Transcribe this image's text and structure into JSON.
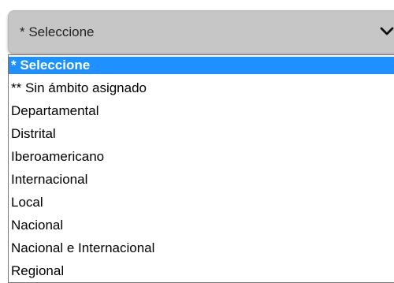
{
  "select": {
    "value": "* Seleccione",
    "icon": "chevron-down-icon"
  },
  "options": [
    {
      "label": "* Seleccione",
      "selected": true
    },
    {
      "label": "** Sin ámbito asignado"
    },
    {
      "label": "Departamental"
    },
    {
      "label": "Distrital"
    },
    {
      "label": "Iberoamericano"
    },
    {
      "label": "Internacional"
    },
    {
      "label": "Local"
    },
    {
      "label": "Nacional"
    },
    {
      "label": "Nacional e Internacional"
    },
    {
      "label": "Regional"
    }
  ],
  "colors": {
    "highlight": "#1e90ff",
    "select_background": "#c6c6c6"
  }
}
